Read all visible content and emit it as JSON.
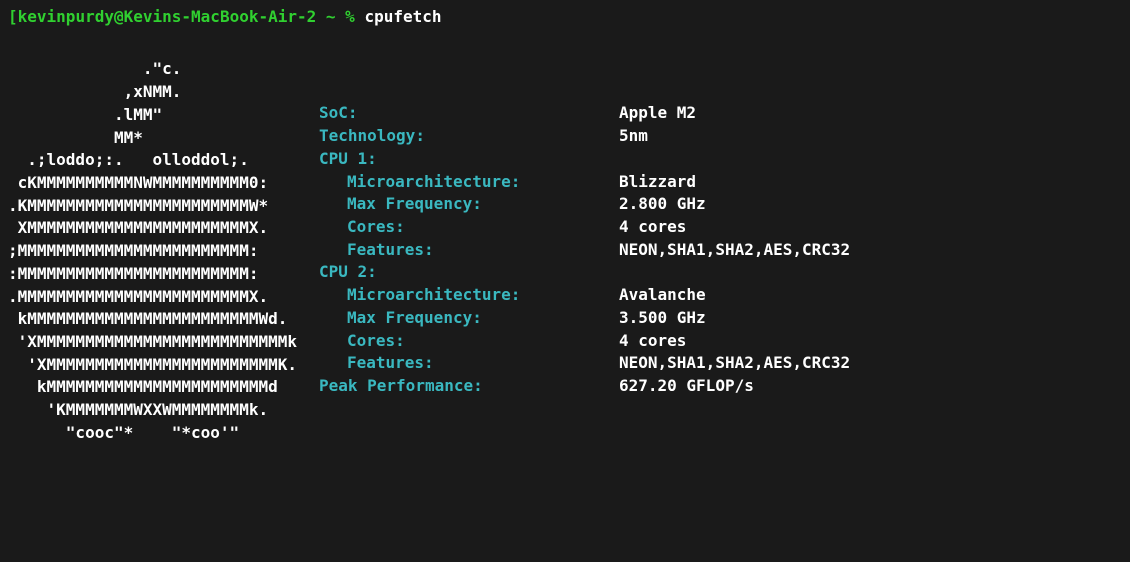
{
  "prompt": {
    "user": "kevinpurdy",
    "host": "Kevins-MacBook-Air-2",
    "path": "~",
    "separator": "%",
    "command": "cpufetch"
  },
  "ascii_art": "              .\"c.\n            ,xNMM.\n           .lMM\"\n           MM*\n  .;loddo;:.   olloddol;.\n cKMMMMMMMMMMNWMMMMMMMMMM0:\n.KMMMMMMMMMMMMMMMMMMMMMMMW*\n XMMMMMMMMMMMMMMMMMMMMMMMX.\n;MMMMMMMMMMMMMMMMMMMMMMMM:\n:MMMMMMMMMMMMMMMMMMMMMMMM:\n.MMMMMMMMMMMMMMMMMMMMMMMMX.\n kMMMMMMMMMMMMMMMMMMMMMMMMWd.\n 'XMMMMMMMMMMMMMMMMMMMMMMMMMMk\n  'XMMMMMMMMMMMMMMMMMMMMMMMMK.\n   kMMMMMMMMMMMMMMMMMMMMMMMd\n    'KMMMMMMMWXXWMMMMMMMMk.\n      \"cooc\"*    \"*coo'\"",
  "info": {
    "soc_label": "SoC:",
    "soc_value": "Apple M2",
    "tech_label": "Technology:",
    "tech_value": "5nm",
    "cpu1_label": "CPU 1:",
    "cpu1": {
      "micro_label": "Microarchitecture:",
      "micro_value": "Blizzard",
      "freq_label": "Max Frequency:",
      "freq_value": "2.800 GHz",
      "cores_label": "Cores:",
      "cores_value": "4 cores",
      "feat_label": "Features:",
      "feat_value": "NEON,SHA1,SHA2,AES,CRC32"
    },
    "cpu2_label": "CPU 2:",
    "cpu2": {
      "micro_label": "Microarchitecture:",
      "micro_value": "Avalanche",
      "freq_label": "Max Frequency:",
      "freq_value": "3.500 GHz",
      "cores_label": "Cores:",
      "cores_value": "4 cores",
      "feat_label": "Features:",
      "feat_value": "NEON,SHA1,SHA2,AES,CRC32"
    },
    "peak_label": "Peak Performance:",
    "peak_value": "627.20 GFLOP/s"
  }
}
